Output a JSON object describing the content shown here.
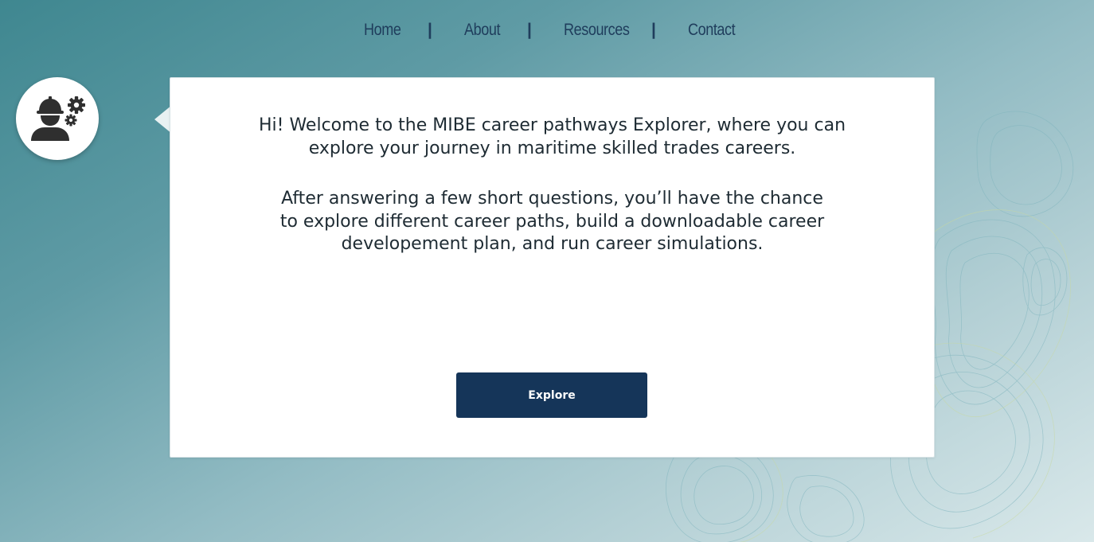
{
  "nav": {
    "items": [
      {
        "label": "Home"
      },
      {
        "label": "About"
      },
      {
        "label": "Resources"
      },
      {
        "label": "Contact"
      }
    ],
    "separator": "|"
  },
  "avatar": {
    "icon": "worker-gears-icon"
  },
  "card": {
    "welcome_text": "Hi! Welcome to the MIBE career pathways Explorer, where you can explore your journey in maritime skilled trades careers.",
    "intro_text": "After answering a few short questions, you’ll have the chance to explore different career paths, build a downloadable career developement plan, and run career simulations.",
    "explore_label": "Explore"
  },
  "colors": {
    "accent": "#153559",
    "nav_text": "#1f3d5c",
    "card_bg": "#ffffff",
    "bg_top_left": "#3f8790",
    "bg_bottom_right": "#d9e8ea"
  }
}
